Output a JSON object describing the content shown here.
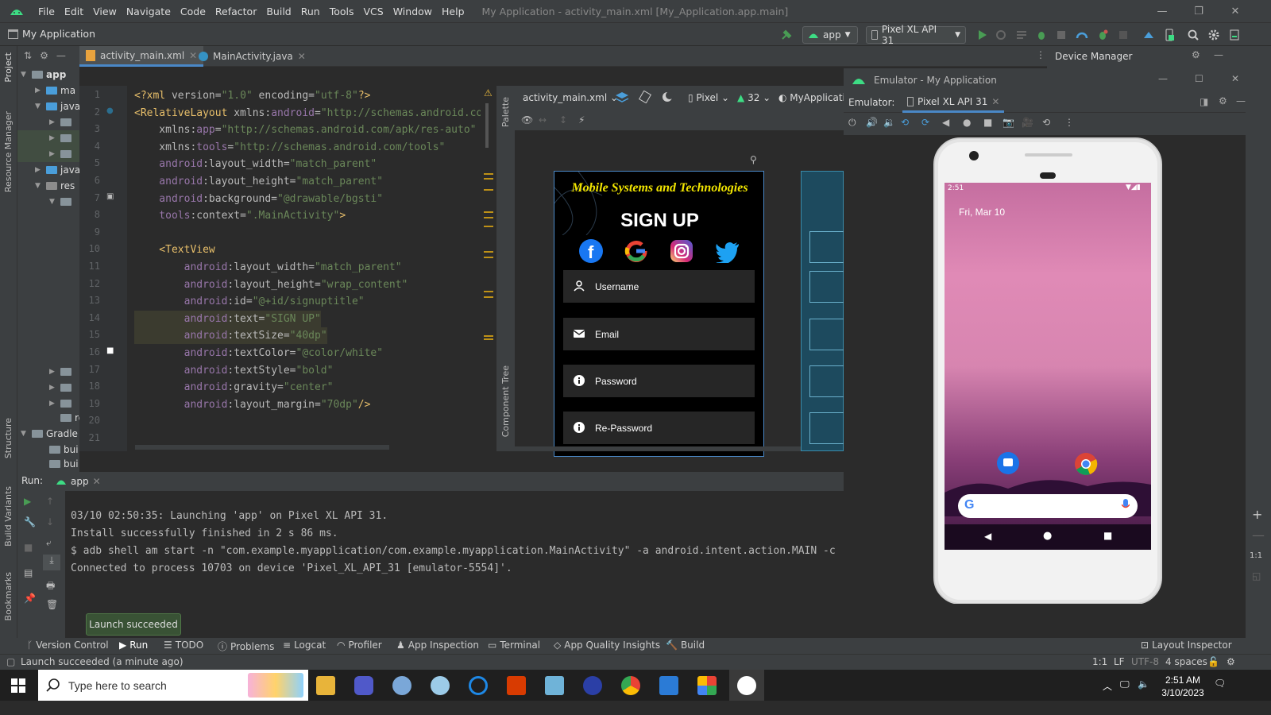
{
  "menu": {
    "items": [
      "File",
      "Edit",
      "View",
      "Navigate",
      "Code",
      "Refactor",
      "Build",
      "Run",
      "Tools",
      "VCS",
      "Window",
      "Help"
    ],
    "window_title": "My Application - activity_main.xml [My_Application.app.main]"
  },
  "toolbar": {
    "project": "My Application",
    "config": "app",
    "device": "Pixel XL API 31"
  },
  "tabs": [
    {
      "label": "activity_main.xml"
    },
    {
      "label": "MainActivity.java"
    }
  ],
  "device_manager": "Device Manager",
  "project_tree": {
    "root": "app",
    "items": [
      "ma",
      "java",
      "java",
      "res",
      "res",
      "Gradle",
      "bui",
      "bui"
    ]
  },
  "code": {
    "line_numbers": [
      "1",
      "2",
      "3",
      "4",
      "5",
      "6",
      "7",
      "8",
      "9",
      "10",
      "11",
      "12",
      "13",
      "14",
      "15",
      "16",
      "17",
      "18",
      "19",
      "20",
      "21"
    ],
    "lines": [
      [
        [
          "k",
          "<?xml "
        ],
        [
          "a",
          "version="
        ],
        [
          "s",
          "\"1.0\""
        ],
        [
          "a",
          " encoding="
        ],
        [
          "s",
          "\"utf-8\""
        ],
        [
          "k",
          "?>"
        ]
      ],
      [
        [
          "k",
          "<RelativeLayout "
        ],
        [
          "a",
          "xmlns:"
        ],
        [
          "ns",
          "android"
        ],
        [
          "a",
          "="
        ],
        [
          "s",
          "\"http://schemas.android.com/"
        ]
      ],
      [
        [
          "a",
          "    xmlns:"
        ],
        [
          "ns",
          "app"
        ],
        [
          "a",
          "="
        ],
        [
          "s",
          "\"http://schemas.android.com/apk/res-auto\""
        ]
      ],
      [
        [
          "a",
          "    xmlns:"
        ],
        [
          "ns",
          "tools"
        ],
        [
          "a",
          "="
        ],
        [
          "s",
          "\"http://schemas.android.com/tools\""
        ]
      ],
      [
        [
          "ns",
          "    android"
        ],
        [
          "a",
          ":layout_width="
        ],
        [
          "s",
          "\"match_parent\""
        ]
      ],
      [
        [
          "ns",
          "    android"
        ],
        [
          "a",
          ":layout_height="
        ],
        [
          "s",
          "\"match_parent\""
        ]
      ],
      [
        [
          "ns",
          "    android"
        ],
        [
          "a",
          ":background="
        ],
        [
          "s",
          "\"@drawable/bgsti\""
        ]
      ],
      [
        [
          "ns",
          "    tools"
        ],
        [
          "a",
          ":context="
        ],
        [
          "s",
          "\".MainActivity\""
        ],
        [
          "k",
          ">"
        ]
      ],
      [
        [
          "a",
          ""
        ]
      ],
      [
        [
          "k",
          "    <TextView"
        ]
      ],
      [
        [
          "ns",
          "        android"
        ],
        [
          "a",
          ":layout_width="
        ],
        [
          "s",
          "\"match_parent\""
        ]
      ],
      [
        [
          "ns",
          "        android"
        ],
        [
          "a",
          ":layout_height="
        ],
        [
          "s",
          "\"wrap_content\""
        ]
      ],
      [
        [
          "ns",
          "        android"
        ],
        [
          "a",
          ":id="
        ],
        [
          "s",
          "\"@+id/signuptitle\""
        ]
      ],
      [
        [
          "ns",
          "        android"
        ],
        [
          "a",
          ":text="
        ],
        [
          "s",
          "\"SIGN UP\""
        ]
      ],
      [
        [
          "ns",
          "        android"
        ],
        [
          "a",
          ":textSize="
        ],
        [
          "s",
          "\"40dp\""
        ]
      ],
      [
        [
          "ns",
          "        android"
        ],
        [
          "a",
          ":textColor="
        ],
        [
          "s",
          "\"@color/white\""
        ]
      ],
      [
        [
          "ns",
          "        android"
        ],
        [
          "a",
          ":textStyle="
        ],
        [
          "s",
          "\"bold\""
        ]
      ],
      [
        [
          "ns",
          "        android"
        ],
        [
          "a",
          ":gravity="
        ],
        [
          "s",
          "\"center\""
        ]
      ],
      [
        [
          "ns",
          "        android"
        ],
        [
          "a",
          ":layout_margin="
        ],
        [
          "s",
          "\"70dp\""
        ],
        [
          "k",
          "/>"
        ]
      ],
      [
        [
          "a",
          ""
        ]
      ],
      [
        [
          "a",
          ""
        ]
      ]
    ]
  },
  "design": {
    "file": "activity_main.xml",
    "device": "Pixel",
    "api": "32",
    "theme": "MyApplicati",
    "palette_label": "Palette",
    "component_tree_label": "Component Tree"
  },
  "preview": {
    "banner": "Mobile Systems  and Technologies",
    "title": "SIGN UP",
    "fields": [
      "Username",
      "Email",
      "Password",
      "Re-Password"
    ]
  },
  "emulator": {
    "title": "Emulator - My Application",
    "label": "Emulator:",
    "device_tab": "Pixel XL API 31",
    "time": "2:51",
    "date": "Fri, Mar 10"
  },
  "run": {
    "label": "Run:",
    "config": "app",
    "output": [
      "03/10 02:50:35: Launching 'app' on Pixel XL API 31.",
      "Install successfully finished in 2 s 86 ms.",
      "$ adb shell am start -n \"com.example.myapplication/com.example.myapplication.MainActivity\" -a android.intent.action.MAIN -c",
      "Connected to process 10703 on device 'Pixel_XL_API_31 [emulator-5554]'."
    ],
    "toast": "Launch succeeded"
  },
  "bottom_tools": [
    "Version Control",
    "Run",
    "TODO",
    "Problems",
    "Logcat",
    "Profiler",
    "App Inspection",
    "Terminal",
    "App Quality Insights",
    "Build"
  ],
  "layout_inspector": "Layout Inspector",
  "status": {
    "message": "Launch succeeded (a minute ago)",
    "pos": "1:1",
    "lf": "LF",
    "enc": "UTF-8",
    "indent": "4 spaces"
  },
  "side_labels": {
    "project": "Project",
    "resource_manager": "Resource Manager",
    "structure": "Structure",
    "build_variants": "Build Variants",
    "bookmarks": "Bookmarks"
  },
  "taskbar": {
    "search_placeholder": "Type here to search",
    "time": "2:51 AM",
    "date": "3/10/2023"
  },
  "colors": {
    "accent_green": "#499c54",
    "android_green": "#3ddc84",
    "selection": "#4a88c7"
  }
}
